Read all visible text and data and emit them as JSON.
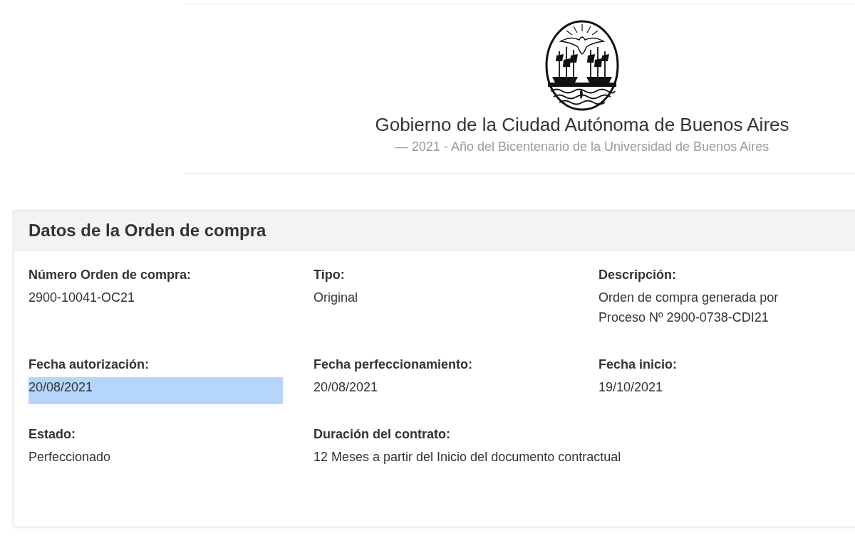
{
  "header": {
    "title": "Gobierno de la Ciudad Autónoma de Buenos Aires",
    "subtitle": "— 2021 - Año del Bicentenario de la Universidad de Buenos Aires"
  },
  "card": {
    "title": "Datos de la Orden de compra",
    "fields": [
      {
        "label": "Número Orden de compra:",
        "value": "2900-10041-OC21",
        "highlighted": false
      },
      {
        "label": "Tipo:",
        "value": "Original",
        "highlighted": false
      },
      {
        "label": "Descripción:",
        "value": "Orden de compra generada por Proceso Nº 2900-0738-CDI21",
        "highlighted": false
      },
      {
        "label": "Fecha autorización:",
        "value": "20/08/2021",
        "highlighted": true
      },
      {
        "label": "Fecha perfeccionamiento:",
        "value": "20/08/2021",
        "highlighted": false
      },
      {
        "label": "Fecha inicio:",
        "value": "19/10/2021",
        "highlighted": false
      },
      {
        "label": "Estado:",
        "value": "Perfeccionado",
        "highlighted": false
      },
      {
        "label": "Duración del contrato:",
        "value": "12 Meses a partir del Inicio del documento contractual",
        "highlighted": false
      }
    ]
  }
}
